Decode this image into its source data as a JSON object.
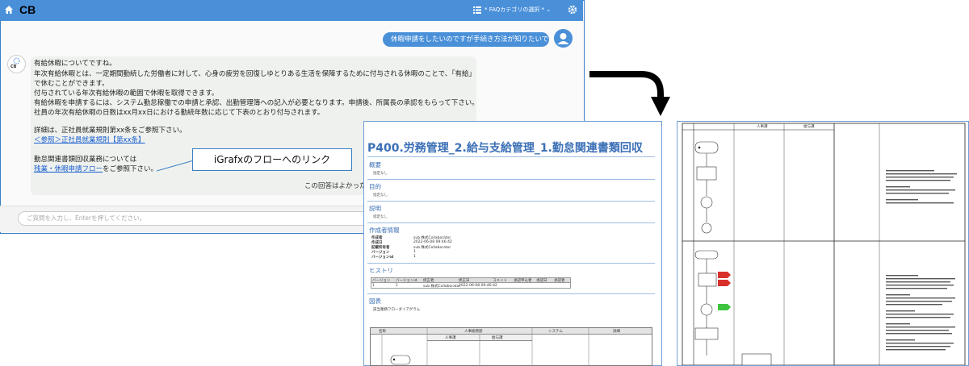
{
  "app": {
    "title": "CB",
    "faq_select": "* FAQカテゴリの選択 *"
  },
  "user_message": "休暇申請をしたいのですが手続き方法が知りたいです",
  "bot": {
    "avatar_label": "CB",
    "lines": [
      "有給休暇についてですね。",
      "年次有給休暇とは、一定期間勤続した労働者に対して、心身の疲労を回復しゆとりある生活を保障するために付与される休暇のことで、「有給」",
      "で休むことができます。",
      "付与されている年次有給休暇の範囲で休暇を取得できます。",
      "有給休暇を申請するには、システム勤怠稼働での申請と承認、出勤管理簿への記入が必要となります。申請後、所属長の承認をもらって下さい。",
      "社員の年次有給休暇の日数はxx月xx日における勤続年数に応じて下表のとおり付与されます。"
    ],
    "detail_line": "詳細は、正社員就業規則第xx条をご参照下さい。",
    "ref_link": "＜参照＞正社員就業規則【第xx条】",
    "business_line": "勤怠関連書類回収業務については",
    "flow_link": "残業・休暇申請フロー",
    "flow_link_suffix": "をご参照下さい。",
    "feedback": "この回答はよかった"
  },
  "callout": "iGrafxのフローへのリンク",
  "input": {
    "placeholder": "ご質問を入力し、Enterを押してください。"
  },
  "doc": {
    "title": "P400.労務管理_2.給与支給管理_1.勤怠関連書類回収",
    "sections": [
      {
        "heading": "概要",
        "value": "指定なし"
      },
      {
        "heading": "目的",
        "value": "指定なし"
      },
      {
        "heading": "説明",
        "value": "指定なし"
      }
    ],
    "author_heading": "作成者情報",
    "author_rows": [
      {
        "label": "作成者",
        "value": "sub 株式Collaborator"
      },
      {
        "label": "作成日",
        "value": "2022-06-08 09:46:42"
      },
      {
        "label": "記載所有者",
        "value": "sub 株式Collaborator"
      },
      {
        "label": "バージョン",
        "value": "1"
      },
      {
        "label": "バージョンid",
        "value": "1"
      }
    ],
    "history_heading": "ヒストリ",
    "history_columns": [
      "バージョン",
      "バージョンid",
      "修正者",
      "修正日",
      "コメント",
      "承認申込者",
      "承認日",
      "承認者"
    ],
    "history_row": [
      "1",
      "1",
      "sub 株式Collaborator",
      "2022-06-08 09:46:42",
      "",
      "",
      "",
      ""
    ],
    "diagram_heading": "図表",
    "diagram_caption": "該当業務フローダイアグラム",
    "flow_columns": [
      "名称",
      "人事総務部",
      "システム",
      "詳細"
    ],
    "flow_subcolumns": [
      "人事課",
      "給与課"
    ]
  },
  "flow": {
    "lanes": [
      "人事課",
      "給与課"
    ],
    "colors": {
      "accent": "#4a90d9",
      "red": "#d9302b",
      "green": "#3ec43e"
    }
  }
}
